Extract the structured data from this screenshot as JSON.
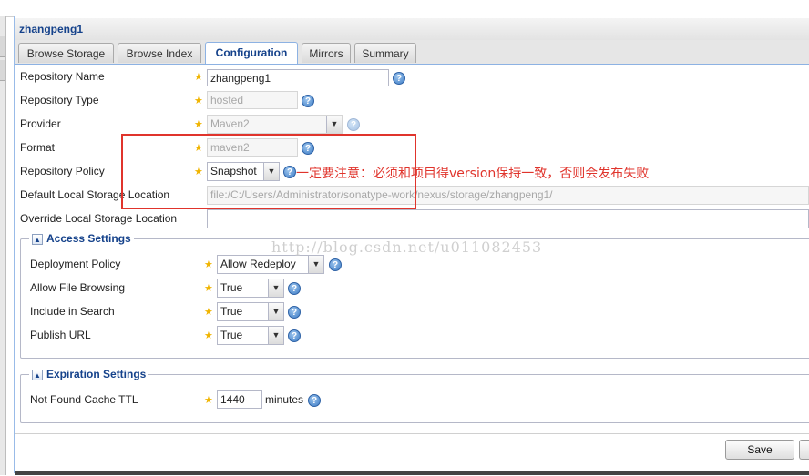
{
  "panel": {
    "title": "zhangpeng1"
  },
  "tabs": [
    {
      "label": "Browse Storage"
    },
    {
      "label": "Browse Index"
    },
    {
      "label": "Configuration"
    },
    {
      "label": "Mirrors"
    },
    {
      "label": "Summary"
    }
  ],
  "form": {
    "repository_name": {
      "label": "Repository Name",
      "value": "zhangpeng1"
    },
    "repository_type": {
      "label": "Repository Type",
      "value": "hosted"
    },
    "provider": {
      "label": "Provider",
      "value": "Maven2"
    },
    "format": {
      "label": "Format",
      "value": "maven2"
    },
    "repository_policy": {
      "label": "Repository Policy",
      "value": "Snapshot"
    },
    "default_storage": {
      "label": "Default Local Storage Location",
      "value": "file:/C:/Users/Administrator/sonatype-work/nexus/storage/zhangpeng1/"
    },
    "override_storage": {
      "label": "Override Local Storage Location",
      "value": ""
    }
  },
  "access": {
    "legend": "Access Settings",
    "deployment_policy": {
      "label": "Deployment Policy",
      "value": "Allow Redeploy"
    },
    "file_browsing": {
      "label": "Allow File Browsing",
      "value": "True"
    },
    "include_search": {
      "label": "Include in Search",
      "value": "True"
    },
    "publish_url": {
      "label": "Publish URL",
      "value": "True"
    }
  },
  "expiration": {
    "legend": "Expiration Settings",
    "not_found_ttl": {
      "label": "Not Found Cache TTL",
      "value": "1440",
      "unit": "minutes"
    }
  },
  "annotation": {
    "text": "一定要注意：必须和项目得version保持一致，否则会发布失败",
    "color": "#e0342c"
  },
  "watermark": {
    "text": "http://blog.csdn.net/u011082453"
  },
  "buttons": {
    "save": "Save"
  }
}
